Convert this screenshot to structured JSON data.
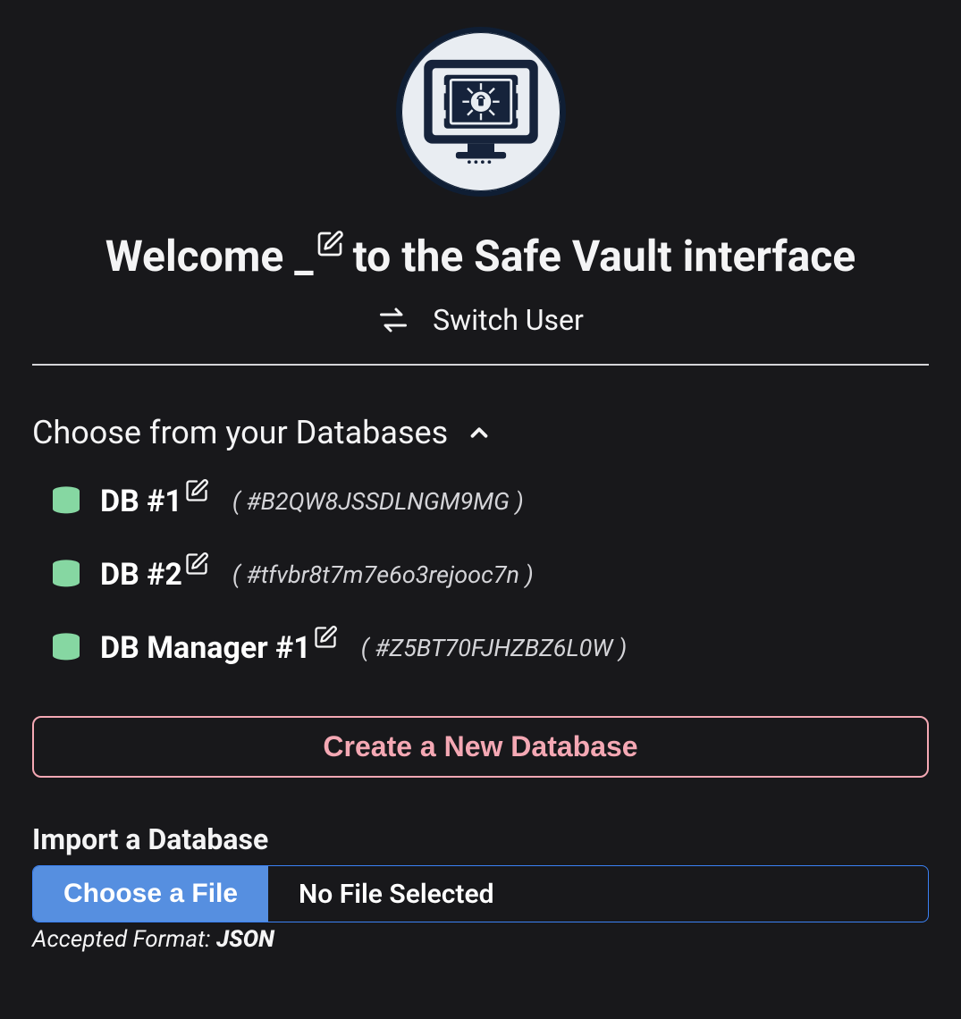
{
  "header": {
    "welcome_pre": "Welcome _",
    "welcome_post": " to the Safe Vault interface",
    "switch_user": "Switch User"
  },
  "databases": {
    "title": "Choose from your Databases",
    "items": [
      {
        "name": "DB #1",
        "id": "( #B2QW8JSSDLNGM9MG )"
      },
      {
        "name": "DB #2",
        "id": "( #tfvbr8t7m7e6o3rejooc7n )"
      },
      {
        "name": "DB Manager #1",
        "id": "( #Z5BT70FJHZBZ6L0W )"
      }
    ]
  },
  "create_button": "Create a New Database",
  "import": {
    "label": "Import a Database",
    "choose": "Choose a File",
    "status": "No File Selected",
    "accepted_prefix": "Accepted Format: ",
    "accepted_format": "JSON"
  },
  "colors": {
    "db_icon": "#86d7a2",
    "create_border": "#f4a8b4",
    "choose_bg": "#568fe0"
  }
}
